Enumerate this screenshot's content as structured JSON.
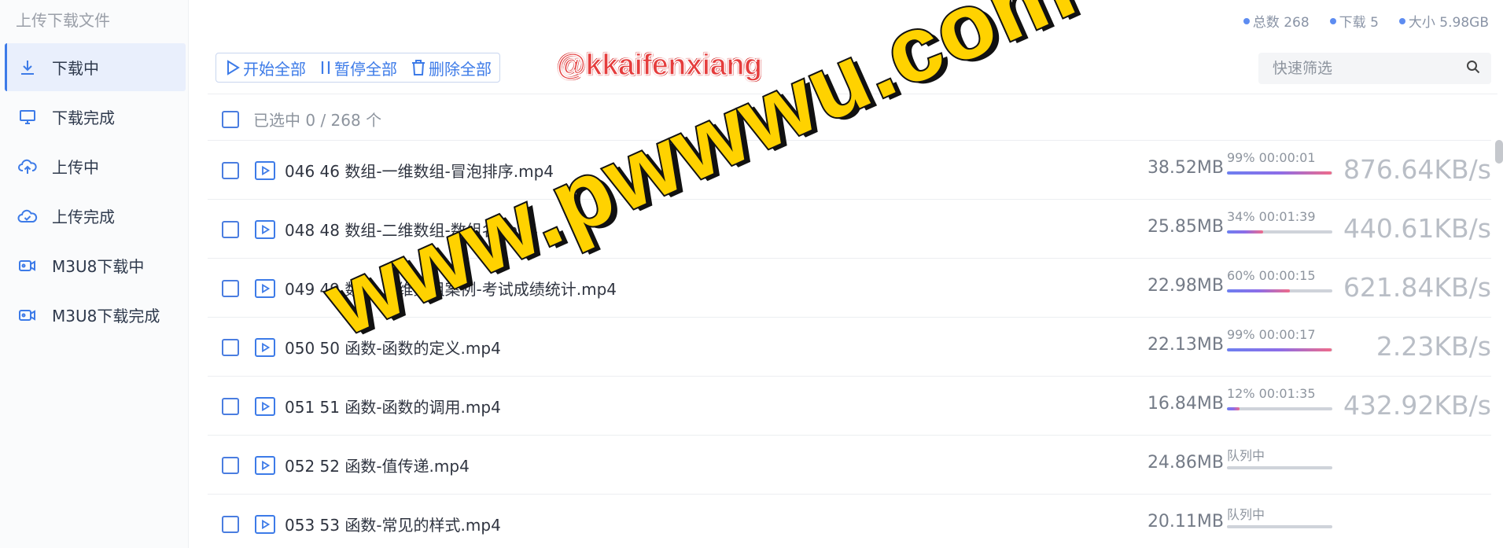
{
  "sidebar": {
    "title": "上传下载文件",
    "items": [
      {
        "label": "下载中",
        "icon": "download-icon",
        "active": true
      },
      {
        "label": "下载完成",
        "icon": "monitor-icon",
        "active": false
      },
      {
        "label": "上传中",
        "icon": "cloud-upload-icon",
        "active": false
      },
      {
        "label": "上传完成",
        "icon": "cloud-check-icon",
        "active": false
      },
      {
        "label": "M3U8下载中",
        "icon": "video-camera-icon",
        "active": false
      },
      {
        "label": "M3U8下载完成",
        "icon": "video-camera-icon",
        "active": false
      }
    ]
  },
  "stats": {
    "total": "总数 268",
    "downloading": "下载 5",
    "size": "大小 5.98GB"
  },
  "toolbar": {
    "start_all": "开始全部",
    "pause_all": "暂停全部",
    "delete_all": "删除全部"
  },
  "watermark_tag": "@kkaifenxiang",
  "search": {
    "placeholder": "快速筛选"
  },
  "selection": {
    "text": "已选中 0 / 268 个"
  },
  "files": [
    {
      "name": "046 46 数组-一维数组-冒泡排序.mp4",
      "size": "38.52MB",
      "status": "99% 00:00:01",
      "progress": 99,
      "speed": "876.64KB/s"
    },
    {
      "name": "048 48 数组-二维数组-数组名.mp4",
      "size": "25.85MB",
      "status": "34% 00:01:39",
      "progress": 34,
      "speed": "440.61KB/s"
    },
    {
      "name": "049 49 数组-二维数组案例-考试成绩统计.mp4",
      "size": "22.98MB",
      "status": "60% 00:00:15",
      "progress": 60,
      "speed": "621.84KB/s"
    },
    {
      "name": "050 50 函数-函数的定义.mp4",
      "size": "22.13MB",
      "status": "99% 00:00:17",
      "progress": 99,
      "speed": "2.23KB/s"
    },
    {
      "name": "051 51 函数-函数的调用.mp4",
      "size": "16.84MB",
      "status": "12% 00:01:35",
      "progress": 12,
      "speed": "432.92KB/s"
    },
    {
      "name": "052 52 函数-值传递.mp4",
      "size": "24.86MB",
      "status": "队列中",
      "progress": 0,
      "speed": ""
    },
    {
      "name": "053 53 函数-常见的样式.mp4",
      "size": "20.11MB",
      "status": "队列中",
      "progress": 0,
      "speed": ""
    }
  ],
  "big_watermark": "www.pwwwu.com",
  "colors": {
    "accent": "#3d7be8",
    "watermark": "#ffd200",
    "tag": "#e53d3d"
  }
}
